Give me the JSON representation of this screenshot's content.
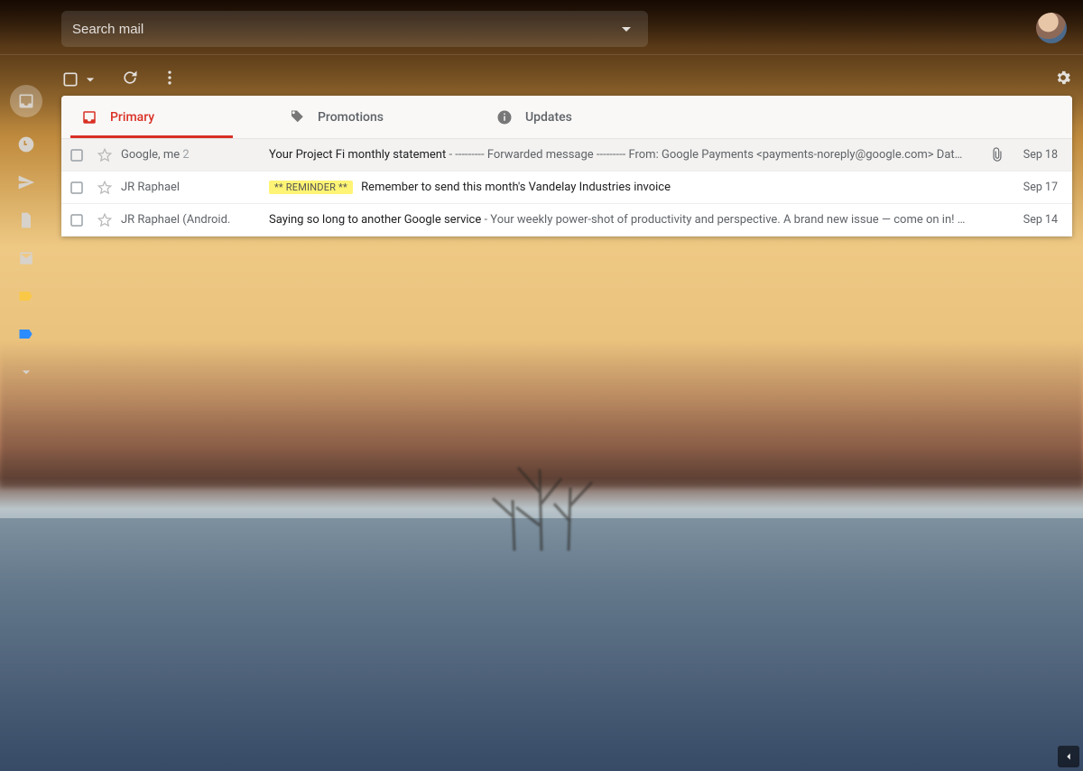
{
  "search": {
    "placeholder": "Search mail"
  },
  "rail": {
    "items": [
      {
        "name": "inbox",
        "selected": true
      },
      {
        "name": "snoozed"
      },
      {
        "name": "sent"
      },
      {
        "name": "drafts"
      },
      {
        "name": "mail"
      },
      {
        "name": "label-yellow",
        "color": "#f9c846"
      },
      {
        "name": "label-blue",
        "color": "#2b8cff"
      },
      {
        "name": "more"
      }
    ]
  },
  "tabs": [
    {
      "key": "primary",
      "label": "Primary",
      "active": true
    },
    {
      "key": "promotions",
      "label": "Promotions"
    },
    {
      "key": "updates",
      "label": "Updates"
    }
  ],
  "messages": [
    {
      "sender": "Google, me",
      "threadCount": "2",
      "subject": "Your Project Fi monthly statement",
      "separator": " - ",
      "snippet": "--------- Forwarded message --------- From: Google Payments <payments-noreply@google.com> Dat…",
      "hasAttachment": true,
      "date": "Sep 18",
      "highlight": true
    },
    {
      "sender": "JR Raphael",
      "badge": "** REMINDER **",
      "subject": "Remember to send this month's Vandelay Industries invoice",
      "separator": "",
      "snippet": "",
      "date": "Sep 17"
    },
    {
      "sender": "JR Raphael (Android.",
      "subject": "Saying so long to another Google service",
      "separator": " - ",
      "snippet": "Your weekly power-shot of productivity and perspective. A brand new issue — come on in! …",
      "date": "Sep 14"
    }
  ]
}
